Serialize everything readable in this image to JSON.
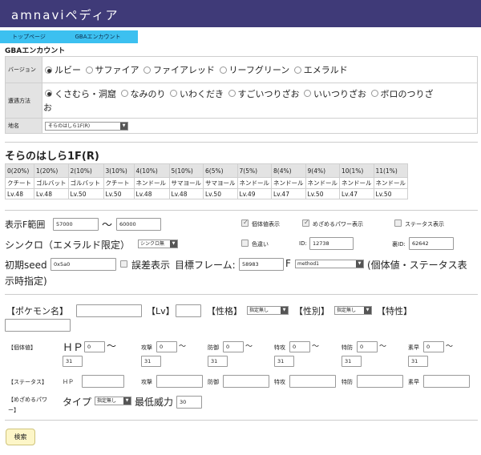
{
  "header": {
    "title": "amnaviペディア"
  },
  "tabs": [
    {
      "label": "トップページ"
    },
    {
      "label": "GBAエンカウント"
    }
  ],
  "section_title": "GBAエンカウント",
  "form": {
    "version_label": "バージョン",
    "versions": [
      "ルビー",
      "サファイア",
      "ファイアレッド",
      "リーフグリーン",
      "エメラルド"
    ],
    "method_label": "遭遇方法",
    "methods_line1": [
      "くさむら・洞窟",
      "なみのり",
      "いわくだき",
      "すごいつりざお",
      "いいつりざお",
      "ボロのつりざ"
    ],
    "methods_line2": "お",
    "location_label": "地名",
    "location_value": "そらのはしら1F(R)"
  },
  "location_title": "そらのはしら1F(R)",
  "encounters": [
    {
      "slot": "0(20%)",
      "name": "クチート",
      "lv": "Lv.48"
    },
    {
      "slot": "1(20%)",
      "name": "ゴルバット",
      "lv": "Lv.48"
    },
    {
      "slot": "2(10%)",
      "name": "ゴルバット",
      "lv": "Lv.50"
    },
    {
      "slot": "3(10%)",
      "name": "クチート",
      "lv": "Lv.50"
    },
    {
      "slot": "4(10%)",
      "name": "ネンドール",
      "lv": "Lv.48"
    },
    {
      "slot": "5(10%)",
      "name": "サマヨール",
      "lv": "Lv.48"
    },
    {
      "slot": "6(5%)",
      "name": "サマヨール",
      "lv": "Lv.50"
    },
    {
      "slot": "7(5%)",
      "name": "ネンドール",
      "lv": "Lv.49"
    },
    {
      "slot": "8(4%)",
      "name": "ネンドール",
      "lv": "Lv.47"
    },
    {
      "slot": "9(4%)",
      "name": "ネンドール",
      "lv": "Lv.50"
    },
    {
      "slot": "10(1%)",
      "name": "ネンドール",
      "lv": "Lv.47"
    },
    {
      "slot": "11(1%)",
      "name": "ネンドール",
      "lv": "Lv.50"
    }
  ],
  "settings": {
    "range_label": "表示F範囲",
    "range_from": "57000",
    "range_sep": "〜",
    "range_to": "60000",
    "iv_display": "個体値表示",
    "hp_display": "めざめるパワー表示",
    "status_display": "ステータス表示",
    "sync_label": "シンクロ（エメラルド限定）",
    "sync_value": "シンクロ無",
    "shiny_label": "色違い",
    "id_label": "ID:",
    "id_value": "12738",
    "sid_label": "裏ID:",
    "sid_value": "62642",
    "seed_label": "初期seed",
    "seed_value": "0x5a0",
    "error_label": "誤差表示",
    "target_label": "目標フレーム:",
    "target_value": "58983",
    "f_label": "F",
    "method_value": "method1",
    "note_1": "(個体値・ステータス表",
    "note_2": "示時指定)"
  },
  "filter": {
    "pokemon_label": "【ポケモン名】",
    "lv_label": "【Lv】",
    "nature_label": "【性格】",
    "nature_value": "指定無し",
    "gender_label": "【性別】",
    "gender_value": "指定無し",
    "ability_label": "【特性】",
    "iv_label": "【個体値】",
    "stats_label": "【ステータス】",
    "hidden_label_1": "【めざめるパワ",
    "hidden_label_2": "ー】",
    "hp_big": "ＨＰ",
    "stats": [
      {
        "label": "攻撃",
        "min": "0",
        "max": "31"
      },
      {
        "label": "防御",
        "min": "0",
        "max": "31"
      },
      {
        "label": "特攻",
        "min": "0",
        "max": "31"
      },
      {
        "label": "特防",
        "min": "0",
        "max": "31"
      },
      {
        "label": "素早",
        "min": "0",
        "max": "31"
      }
    ],
    "hp_min": "0",
    "hp_max": "31",
    "tilde": "〜",
    "stat_hp": "ＨＰ",
    "type_label": "タイプ",
    "type_value": "指定無し",
    "min_power_label": "最低威力",
    "min_power_value": "30"
  },
  "search_button": "検索"
}
